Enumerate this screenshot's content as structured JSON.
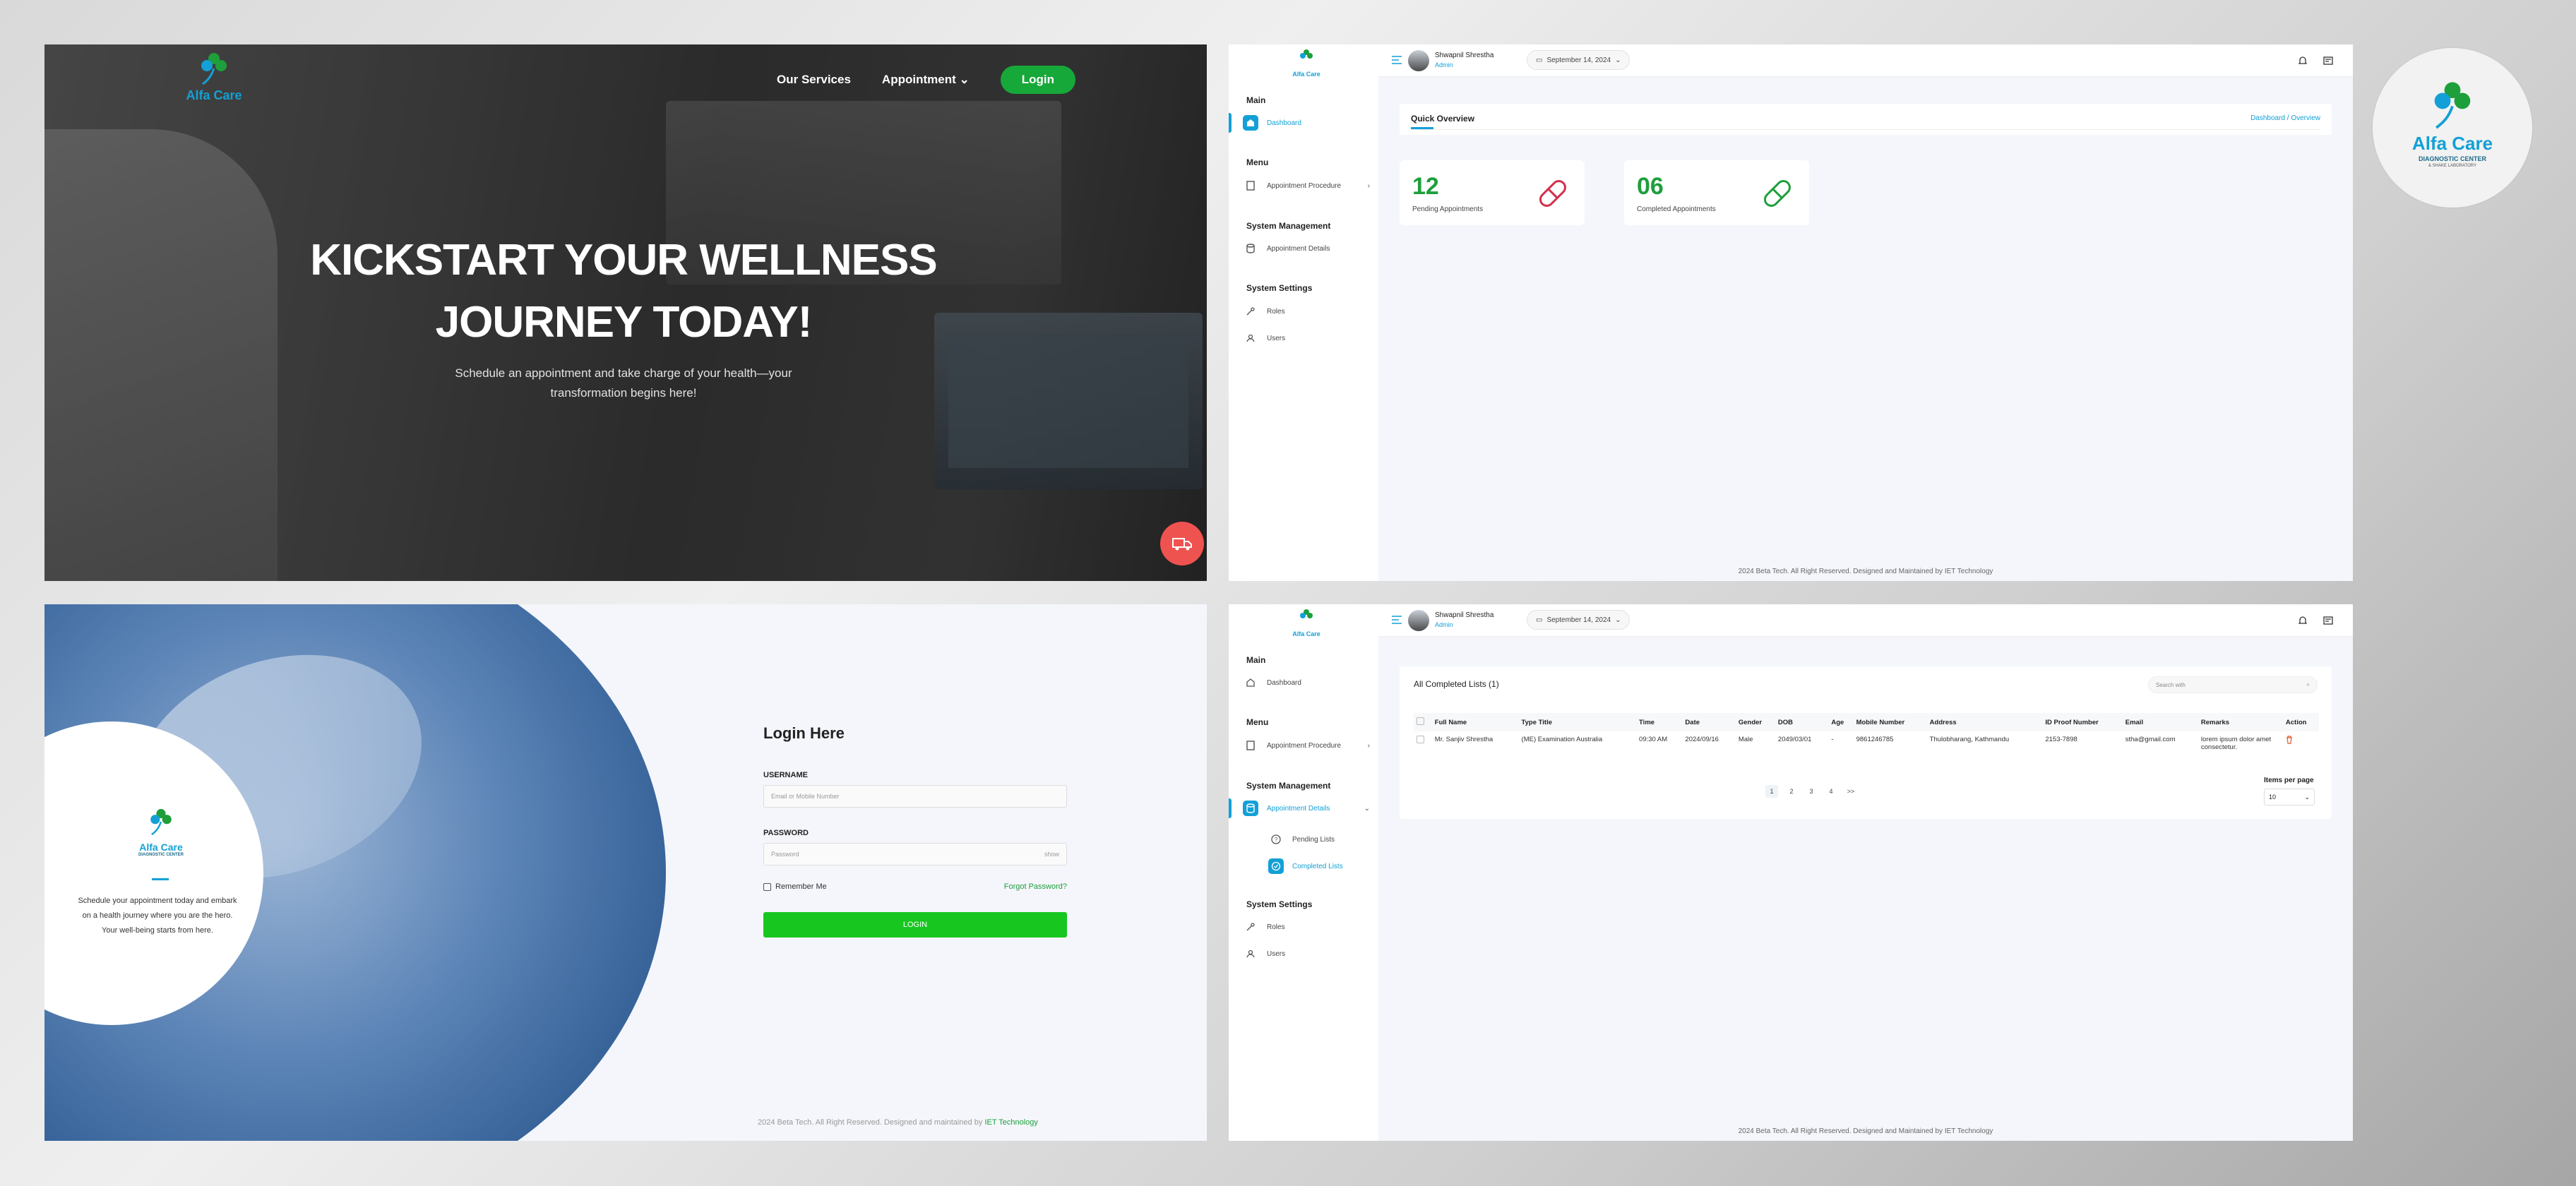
{
  "brand": {
    "name": "Alfa Care",
    "subtitle": "DIAGNOSTIC CENTER",
    "tagline": "& SHAKE LABORATORY",
    "accent": "#13a0d6",
    "green": "#1e9f3c"
  },
  "landing": {
    "nav_services": "Our Services",
    "nav_appointment": "Appointment",
    "login_label": "Login",
    "hero_line1": "KICKSTART YOUR WELLNESS",
    "hero_line2": "JOURNEY TODAY!",
    "hero_sub": "Schedule an appointment and take charge of your health—your transformation begins here!"
  },
  "dashboard": {
    "user_name": "Shwapnil Shrestha",
    "user_role": "Admin",
    "date": "September 14, 2024",
    "sidebar": {
      "main": "Main",
      "dashboard": "Dashboard",
      "menu": "Menu",
      "appointment_procedure": "Appointment Procedure",
      "system_management": "System Management",
      "appointment_details": "Appointment Details",
      "system_settings": "System Settings",
      "roles": "Roles",
      "users": "Users",
      "pending_lists": "Pending Lists",
      "completed_lists": "Completed Lists"
    },
    "quick_overview": "Quick Overview",
    "breadcrumb": "Dashboard / Overview",
    "stats": [
      {
        "value": "12",
        "label": "Pending Appointments",
        "color": "#d32f4a"
      },
      {
        "value": "06",
        "label": "Completed Appointments",
        "color": "#1e9f3c"
      }
    ],
    "footer": "2024 Beta Tech. All Right Reserved. Designed and Maintained by IET Technology"
  },
  "login": {
    "left_text_1": "Schedule your appointment today and embark",
    "left_text_2": "on a health journey where you are the hero.",
    "left_text_3": "Your well-being starts from here.",
    "title": "Login Here",
    "username_label": "USERNAME",
    "username_placeholder": "Email or Mobile Number",
    "password_label": "PASSWORD",
    "password_placeholder": "Password",
    "show": "show",
    "remember": "Remember Me",
    "forgot": "Forgot Password?",
    "button": "LOGIN",
    "footer_text": "2024 Beta Tech. All Right Reserved. Designed and maintained by",
    "footer_link": "IET Technology"
  },
  "completed": {
    "title": "All Completed Lists (1)",
    "search_placeholder": "Search with",
    "columns": [
      "Full Name",
      "Type Title",
      "Time",
      "Date",
      "Gender",
      "DOB",
      "Age",
      "Mobile Number",
      "Address",
      "ID Proof Number",
      "Email",
      "Remarks",
      "Action"
    ],
    "rows": [
      [
        "Mr. Sanjiv Shrestha",
        "(ME) Examination Australia",
        "09:30 AM",
        "2024/09/16",
        "Male",
        "2049/03/01",
        "-",
        "9861246785",
        "Thulobharang, Kathmandu",
        "2153-7898",
        "stha@gmail.com",
        "lorem ipsum dolor amet consectetur."
      ]
    ],
    "pages": [
      "1",
      "2",
      "3",
      "4",
      ">>"
    ],
    "items_per_page_label": "Items per page",
    "items_per_page": "10",
    "footer": "2024 Beta Tech. All Right Reserved. Designed and Maintained by IET Technology"
  }
}
